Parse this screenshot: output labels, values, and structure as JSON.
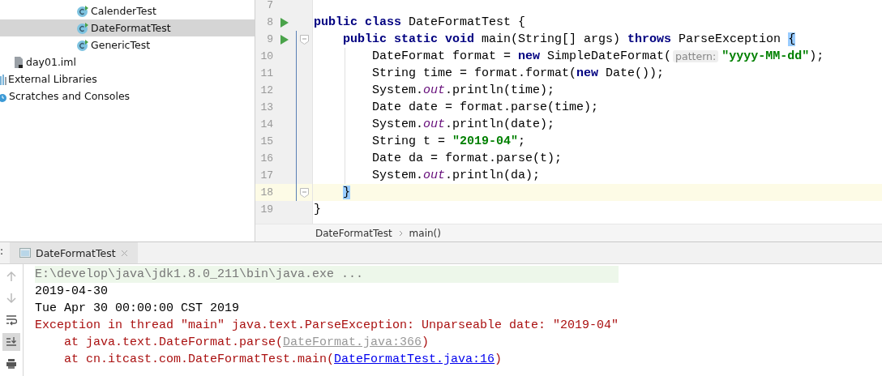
{
  "project_tree": {
    "items": [
      {
        "kind": "class",
        "label": "CalenderTest",
        "selected": false
      },
      {
        "kind": "class",
        "label": "DateFormatTest",
        "selected": true
      },
      {
        "kind": "class",
        "label": "GenericTest",
        "selected": false
      },
      {
        "kind": "iml",
        "label": "day01.iml",
        "selected": false
      },
      {
        "kind": "libraries",
        "label": "External Libraries",
        "selected": false
      },
      {
        "kind": "scratches",
        "label": "Scratches and Consoles",
        "selected": false
      }
    ]
  },
  "editor": {
    "lines": [
      {
        "number": "7",
        "run_marker": false,
        "fold": false,
        "current": false
      },
      {
        "number": "8",
        "run_marker": true,
        "fold": false,
        "current": false,
        "tokens": [
          {
            "kind": "kw",
            "text": "public class "
          },
          {
            "kind": "plain",
            "text": "DateFormatTest {"
          }
        ]
      },
      {
        "number": "9",
        "run_marker": true,
        "fold": true,
        "current": false,
        "tokens": [
          {
            "kind": "kw",
            "text": "    public static void "
          },
          {
            "kind": "plain",
            "text": "main(String[] args) "
          },
          {
            "kind": "kw",
            "text": "throws "
          },
          {
            "kind": "plain",
            "text": "ParseException "
          },
          {
            "kind": "brace",
            "text": "{"
          }
        ]
      },
      {
        "number": "10",
        "run_marker": false,
        "fold": false,
        "current": false,
        "tokens": [
          {
            "kind": "plain",
            "text": "        DateFormat format = "
          },
          {
            "kind": "kw",
            "text": "new "
          },
          {
            "kind": "plain",
            "text": "SimpleDateFormat("
          },
          {
            "kind": "hint",
            "text": "pattern:"
          },
          {
            "kind": "str",
            "text": "\"yyyy-MM-dd\""
          },
          {
            "kind": "plain",
            "text": ");"
          }
        ]
      },
      {
        "number": "11",
        "run_marker": false,
        "fold": false,
        "current": false,
        "tokens": [
          {
            "kind": "plain",
            "text": "        String time = format.format("
          },
          {
            "kind": "kw",
            "text": "new "
          },
          {
            "kind": "plain",
            "text": "Date());"
          }
        ]
      },
      {
        "number": "12",
        "run_marker": false,
        "fold": false,
        "current": false,
        "tokens": [
          {
            "kind": "plain",
            "text": "        System."
          },
          {
            "kind": "field",
            "text": "out"
          },
          {
            "kind": "plain",
            "text": ".println(time);"
          }
        ]
      },
      {
        "number": "13",
        "run_marker": false,
        "fold": false,
        "current": false,
        "tokens": [
          {
            "kind": "plain",
            "text": "        Date date = format.parse(time);"
          }
        ]
      },
      {
        "number": "14",
        "run_marker": false,
        "fold": false,
        "current": false,
        "tokens": [
          {
            "kind": "plain",
            "text": "        System."
          },
          {
            "kind": "field",
            "text": "out"
          },
          {
            "kind": "plain",
            "text": ".println(date);"
          }
        ]
      },
      {
        "number": "15",
        "run_marker": false,
        "fold": false,
        "current": false,
        "tokens": [
          {
            "kind": "plain",
            "text": "        String t = "
          },
          {
            "kind": "str",
            "text": "\"2019-04\""
          },
          {
            "kind": "plain",
            "text": ";"
          }
        ]
      },
      {
        "number": "16",
        "run_marker": false,
        "fold": false,
        "current": false,
        "tokens": [
          {
            "kind": "plain",
            "text": "        Date da = format.parse(t);"
          }
        ]
      },
      {
        "number": "17",
        "run_marker": false,
        "fold": false,
        "current": false,
        "tokens": [
          {
            "kind": "plain",
            "text": "        System."
          },
          {
            "kind": "field",
            "text": "out"
          },
          {
            "kind": "plain",
            "text": ".println(da);"
          }
        ]
      },
      {
        "number": "18",
        "run_marker": false,
        "fold": true,
        "current": true,
        "tokens": [
          {
            "kind": "brace",
            "text": "    }"
          }
        ]
      },
      {
        "number": "19",
        "run_marker": false,
        "fold": false,
        "current": false,
        "tokens": [
          {
            "kind": "plain",
            "text": "}"
          }
        ]
      }
    ],
    "breadcrumbs": [
      "DateFormatTest",
      "main()"
    ]
  },
  "run_panel": {
    "label": ":",
    "tabs": [
      {
        "label": "DateFormatTest",
        "selected": true
      }
    ],
    "toolbar": [
      {
        "kind": "up",
        "selected": false
      },
      {
        "kind": "down",
        "selected": false
      },
      {
        "kind": "wrap",
        "selected": false
      },
      {
        "kind": "scroll-end",
        "selected": true
      },
      {
        "kind": "print",
        "selected": false
      }
    ],
    "console": [
      {
        "kind": "cmd",
        "parts": [
          {
            "kind": "text",
            "text": "E:\\develop\\java\\jdk1.8.0_211\\bin\\java.exe ..."
          }
        ]
      },
      {
        "kind": "out",
        "parts": [
          {
            "kind": "text",
            "text": "2019-04-30"
          }
        ]
      },
      {
        "kind": "out",
        "parts": [
          {
            "kind": "text",
            "text": "Tue Apr 30 00:00:00 CST 2019"
          }
        ]
      },
      {
        "kind": "err",
        "parts": [
          {
            "kind": "text",
            "text": "Exception in thread \"main\" java.text.ParseException: Unparseable date: \"2019-04\""
          }
        ]
      },
      {
        "kind": "err",
        "parts": [
          {
            "kind": "text",
            "text": "    at java.text.DateFormat.parse("
          },
          {
            "kind": "lib-link",
            "text": "DateFormat.java:366"
          },
          {
            "kind": "text",
            "text": ")"
          }
        ]
      },
      {
        "kind": "err",
        "parts": [
          {
            "kind": "text",
            "text": "    at cn.itcast.com.DateFormatTest.main("
          },
          {
            "kind": "link",
            "text": "DateFormatTest.java:16"
          },
          {
            "kind": "text",
            "text": ")"
          }
        ]
      }
    ]
  }
}
